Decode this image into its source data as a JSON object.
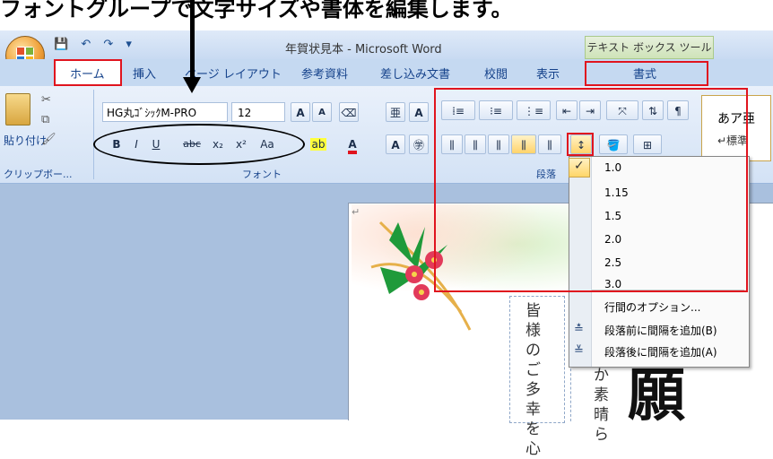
{
  "caption": "フォントグループで文字サイズや書体を編集します。",
  "quick_access": {
    "save_icon": "save-icon",
    "undo_icon": "undo-icon",
    "redo_icon": "redo-icon",
    "more_icon": "more-icon"
  },
  "window_title": "年賀状見本 - Microsoft Word",
  "context_tab_header": "テキスト ボックス ツール",
  "tabs": {
    "home": "ホーム",
    "insert": "挿入",
    "page_layout": "ページ レイアウト",
    "references": "参考資料",
    "mailings": "差し込み文書",
    "review": "校閲",
    "view": "表示",
    "format": "書式"
  },
  "clipboard": {
    "paste_label": "貼り付け",
    "group_label": "クリップボー..."
  },
  "font": {
    "name": "HG丸ｺﾞｼｯｸM-PRO",
    "size": "12",
    "group_label": "フォント",
    "buttons": {
      "bold": "B",
      "italic": "I",
      "underline": "U",
      "strike": "abc",
      "subscript": "x₂",
      "superscript": "x²",
      "case": "Aa",
      "grow": "A",
      "shrink": "A"
    }
  },
  "paragraph": {
    "group_label": "段落"
  },
  "styles": {
    "sample": "あア亜",
    "normal": "↵標準"
  },
  "line_spacing_menu": {
    "items": [
      "1.0",
      "1.15",
      "1.5",
      "2.0",
      "2.5",
      "3.0"
    ],
    "checked": "1.0",
    "options": "行間のオプション...",
    "add_before": "段落前に間隔を追加(B)",
    "add_after": "段落後に間隔を追加(A)"
  },
  "document": {
    "return_mark": "↵",
    "vertical_text_1": "皆様のご多幸を心",
    "vertical_text_2": "か素晴ら",
    "big_kanji": "願"
  },
  "colors": {
    "highlight": "#e0141e",
    "ribbon": "#d3e2f5",
    "tabbar": "#c5d9f1"
  }
}
